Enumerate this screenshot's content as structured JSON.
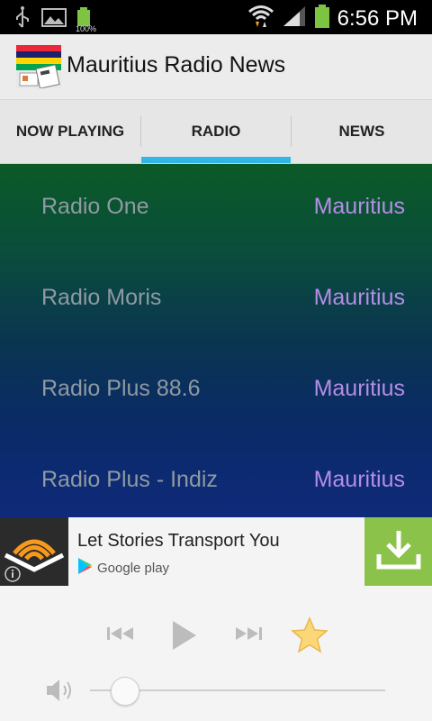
{
  "statusbar": {
    "time": "6:56 PM",
    "battery_small": "100%"
  },
  "app": {
    "title": "Mauritius Radio News"
  },
  "tabs": [
    {
      "label": "NOW PLAYING"
    },
    {
      "label": "RADIO"
    },
    {
      "label": "NEWS"
    }
  ],
  "stations": [
    {
      "name": "Radio One",
      "country": "Mauritius"
    },
    {
      "name": "Radio Moris",
      "country": "Mauritius"
    },
    {
      "name": "Radio Plus 88.6",
      "country": "Mauritius"
    },
    {
      "name": "Radio Plus - Indiz",
      "country": "Mauritius"
    }
  ],
  "ad": {
    "title": "Let Stories Transport You",
    "store": "Google play"
  },
  "player": {
    "volume_fraction": 0.12
  },
  "colors": {
    "tab_indicator": "#33b5e5",
    "country_text": "#b48de6",
    "download_button": "#8bc34a"
  }
}
